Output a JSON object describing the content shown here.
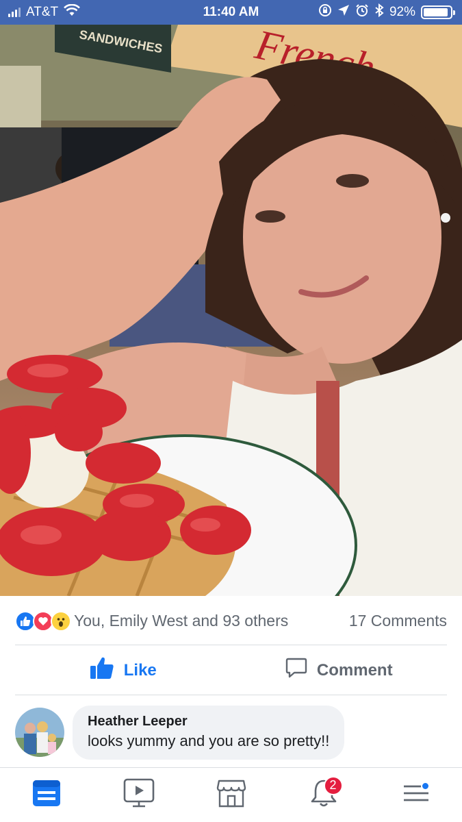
{
  "status_bar": {
    "carrier": "AT&T",
    "time": "11:40 AM",
    "battery_percent": "92%",
    "battery_level": 0.92
  },
  "post": {
    "reactions_summary": "You, Emily West and 93 others",
    "comments_count": "17 Comments",
    "like_label": "Like",
    "comment_label": "Comment",
    "photo": {
      "sign_text_1": "French",
      "sign_text_2": "SANDWICHES"
    }
  },
  "comment": {
    "author": "Heather Leeper",
    "text": "looks yummy and you are so pretty!!"
  },
  "tab_bar": {
    "notifications_badge": "2"
  },
  "colors": {
    "status_bar_bg": "#4267b2",
    "accent": "#1877f2",
    "badge": "#e41e3f",
    "love": "#f33e58",
    "wow": "#fcd13f"
  }
}
